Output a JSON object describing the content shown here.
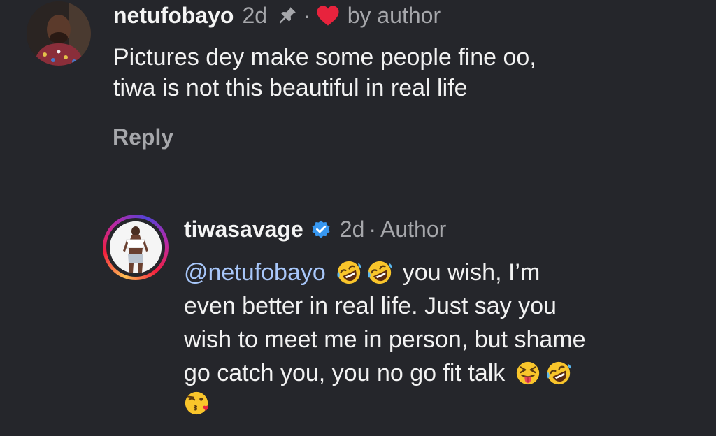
{
  "comment": {
    "username": "netufobayo",
    "time": "2d",
    "separator": "·",
    "liked_label": "by author",
    "text_lines": [
      "Pictures dey make some people fine oo,",
      "tiwa is not this beautiful in real life"
    ],
    "reply_label": "Reply",
    "icons": [
      "pin-icon",
      "heart-icon"
    ],
    "heart_color": "#e8233d"
  },
  "reply": {
    "username": "tiwasavage",
    "verified": true,
    "time": "2d",
    "separator": "·",
    "role_label": "Author",
    "mention": "@netufobayo",
    "line1_rest": "you wish, I’m",
    "line2": "even better in real life. Just say you",
    "line3": "wish to meet me in person, but shame",
    "line4": "go catch you, you no go fit talk",
    "emojis_line1": [
      "rolling-on-floor-laughing",
      "rolling-on-floor-laughing"
    ],
    "emojis_line4": [
      "squinting-face-with-tongue",
      "rolling-on-floor-laughing"
    ],
    "emojis_line5": [
      "face-blowing-a-kiss"
    ],
    "mention_color": "#a8c7fa",
    "verified_color": "#3797f0"
  }
}
